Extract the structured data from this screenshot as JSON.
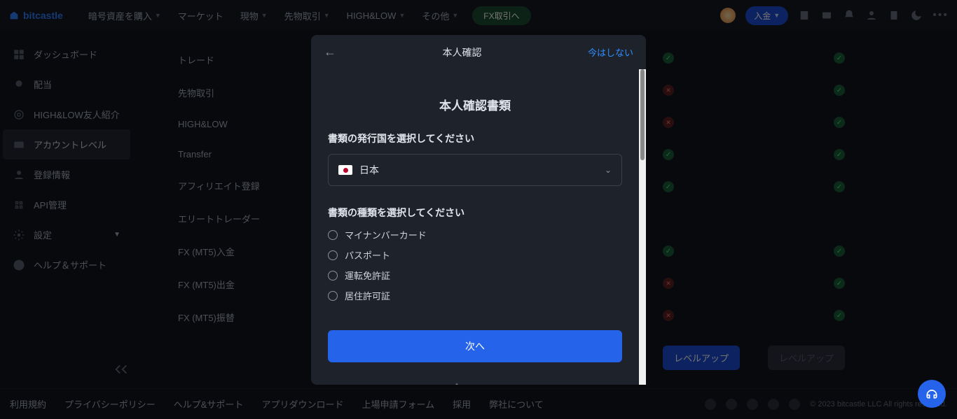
{
  "brand": "bitcastle",
  "nav": [
    "暗号資産を購入",
    "マーケット",
    "現物",
    "先物取引",
    "HIGH&LOW",
    "その他"
  ],
  "nav_has_caret": [
    true,
    false,
    true,
    true,
    true,
    true
  ],
  "fx_button": "FX取引へ",
  "deposit_button": "入金",
  "sidebar": [
    {
      "label": "ダッシュボード",
      "icon": "dashboard"
    },
    {
      "label": "配当",
      "icon": "medal"
    },
    {
      "label": "HIGH&LOW友人紹介",
      "icon": "target"
    },
    {
      "label": "アカウントレベル",
      "icon": "card",
      "active": true
    },
    {
      "label": "登録情報",
      "icon": "user"
    },
    {
      "label": "API管理",
      "icon": "api"
    },
    {
      "label": "設定",
      "icon": "gear",
      "chevron": true
    },
    {
      "label": "ヘルプ＆サポート",
      "icon": "help"
    }
  ],
  "subsidebar": [
    "トレード",
    "先物取引",
    "HIGH&LOW",
    "Transfer",
    "アフィリエイト登録",
    "エリートトレーダー",
    "FX (MT5)入金",
    "FX (MT5)出金",
    "FX (MT5)振替"
  ],
  "modal": {
    "header_title": "本人確認",
    "skip": "今はしない",
    "body_title": "本人確認書類",
    "country_label": "書類の発行国を選択してください",
    "country_value": "日本",
    "doctype_label": "書類の種類を選択してください",
    "options": [
      "マイナンバーカード",
      "パスポート",
      "運転免許証",
      "居住許可証"
    ],
    "next": "次へ",
    "provider": "sumsub"
  },
  "bg_rows": [
    {
      "left": "green",
      "right": "green"
    },
    {
      "left": "red",
      "right": "green"
    },
    {
      "left": "red",
      "right": "green"
    },
    {
      "left": "green",
      "right": "green"
    },
    {
      "left": "green",
      "right": "green"
    },
    {
      "left": "none",
      "right": "none"
    },
    {
      "left": "green",
      "right": "green"
    },
    {
      "left": "red",
      "right": "green"
    },
    {
      "left": "red",
      "right": "green"
    }
  ],
  "level_up": "レベルアップ",
  "footer": [
    "利用規約",
    "プライバシーポリシー",
    "ヘルプ&サポート",
    "アプリダウンロード",
    "上場申請フォーム",
    "採用",
    "弊社について"
  ],
  "copyright": "© 2023 bitcastle LLC All rights reserved."
}
